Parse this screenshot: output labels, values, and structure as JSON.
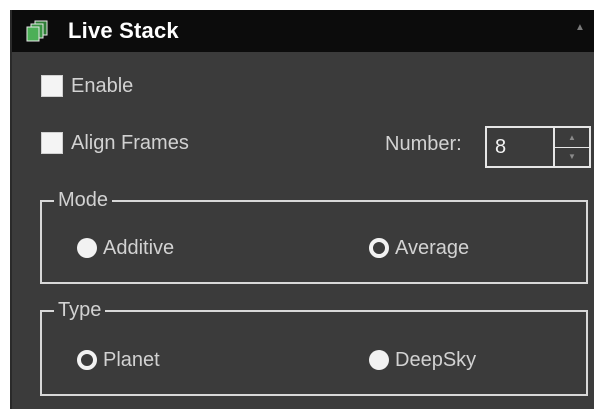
{
  "panel": {
    "title": "Live Stack",
    "header_icon": "stack-icon",
    "collapse_icon": "collapse-caret-icon"
  },
  "options": {
    "enable": {
      "label": "Enable",
      "checked": false
    },
    "align_frames": {
      "label": "Align Frames",
      "checked": false
    }
  },
  "number": {
    "label": "Number:",
    "value": "8"
  },
  "mode": {
    "title": "Mode",
    "options": [
      {
        "label": "Additive",
        "selected": false
      },
      {
        "label": "Average",
        "selected": true
      }
    ]
  },
  "type": {
    "title": "Type",
    "options": [
      {
        "label": "Planet",
        "selected": true
      },
      {
        "label": "DeepSky",
        "selected": false
      }
    ]
  },
  "colors": {
    "panel_bg": "#3b3b3b",
    "header_bg": "#0c0c0c",
    "text": "#d2d2d2",
    "title_text": "#ffffff",
    "icon_green": "#3f9c4a"
  }
}
